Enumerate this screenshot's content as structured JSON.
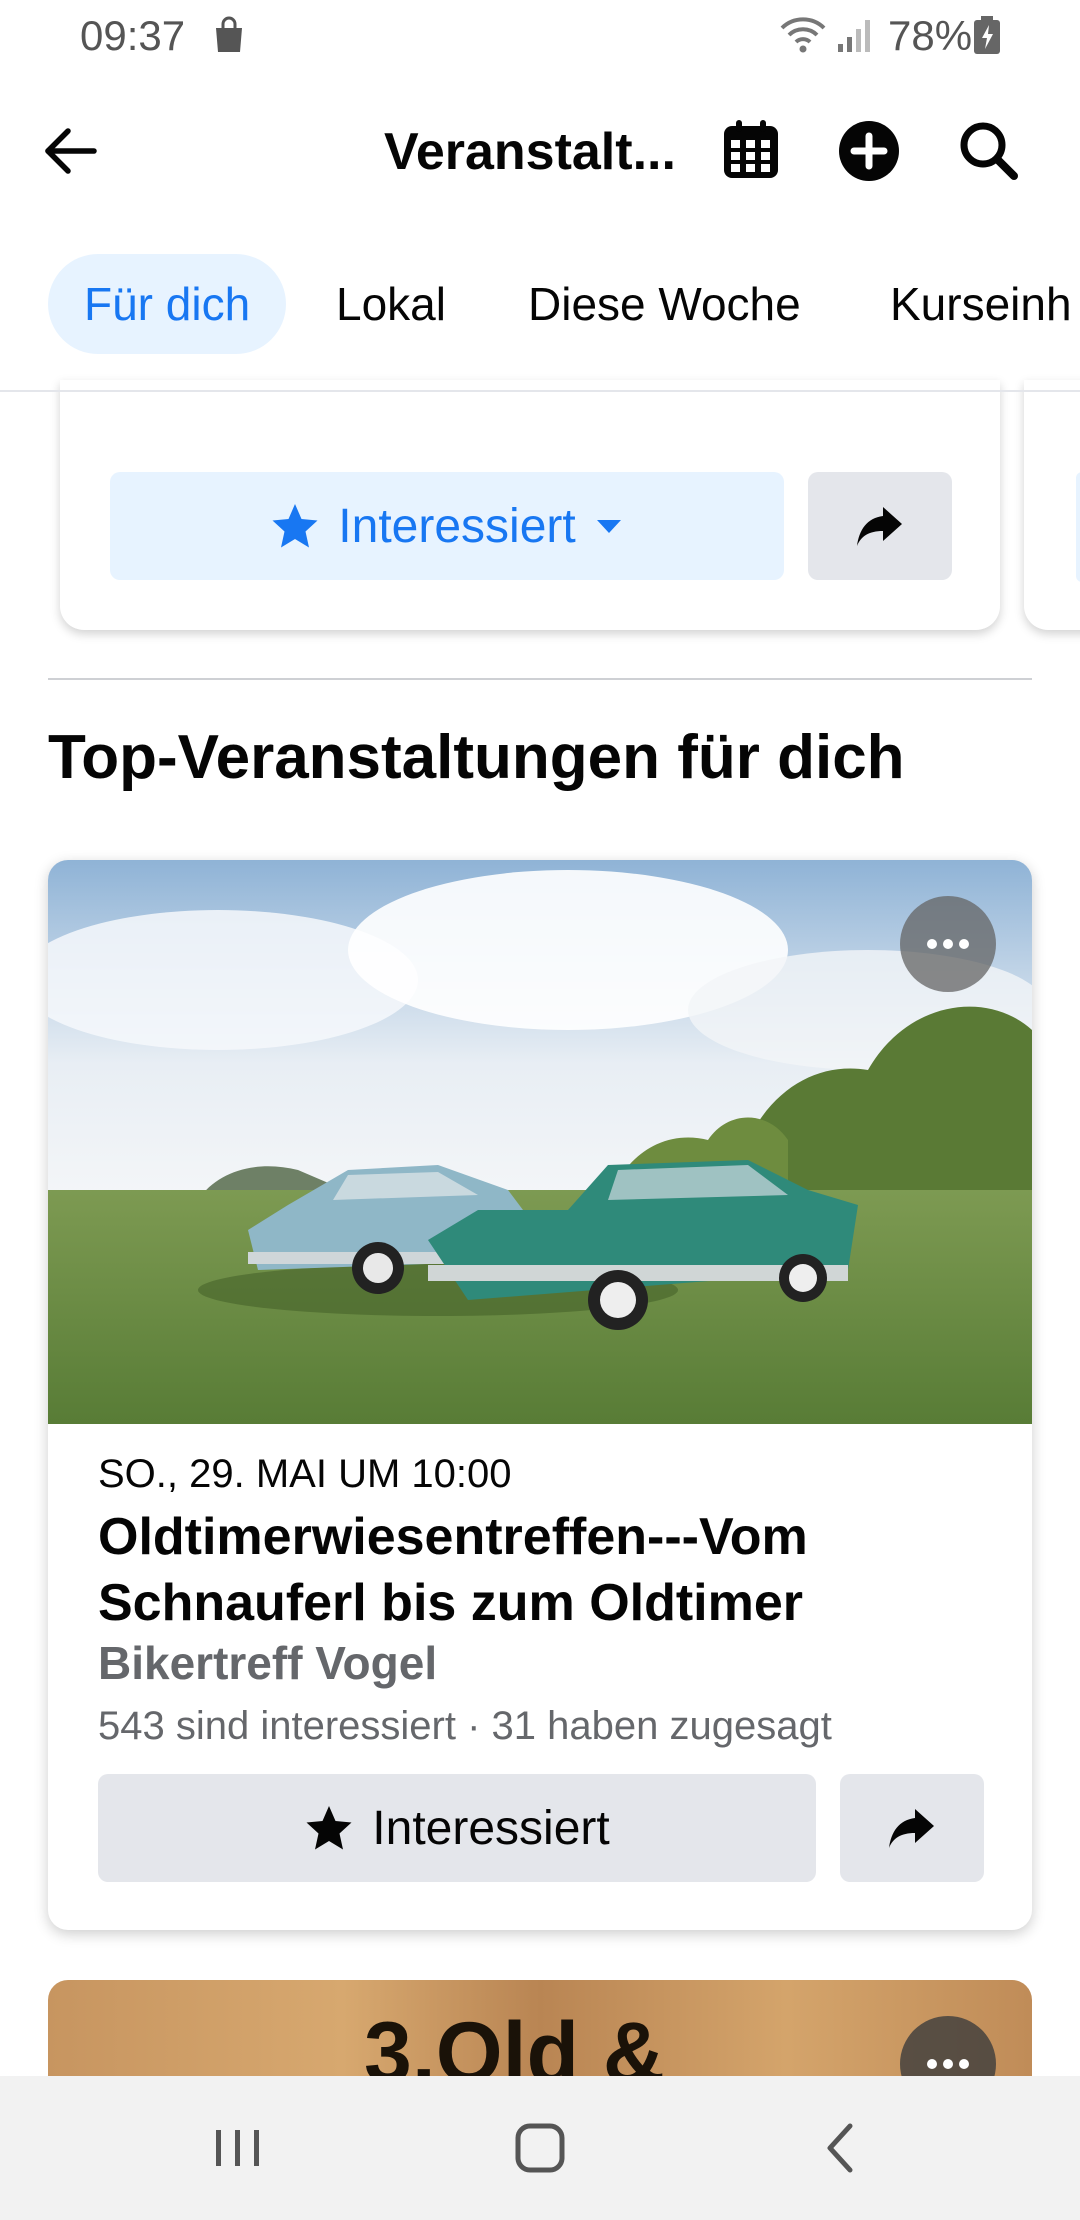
{
  "status_bar": {
    "time": "09:37",
    "battery": "78%",
    "icons": [
      "shopping-bag-icon",
      "wifi-icon",
      "signal-icon",
      "battery-icon"
    ]
  },
  "header": {
    "title": "Veranstalt...",
    "icons": [
      "back-arrow-icon",
      "calendar-icon",
      "plus-circle-icon",
      "search-icon"
    ]
  },
  "tabs": [
    {
      "label": "Für dich",
      "active": true
    },
    {
      "label": "Lokal",
      "active": false
    },
    {
      "label": "Diese Woche",
      "active": false
    },
    {
      "label": "Kurseinh",
      "active": false
    }
  ],
  "previous_card": {
    "interested_label": "Interessiert"
  },
  "section": {
    "title": "Top-Veranstaltungen für dich"
  },
  "event": {
    "date": "SO., 29. MAI UM 10:00",
    "title": "Oldtimerwiesentreffen---Vom Schnauferl bis zum Oldtimer",
    "place": "Bikertreff Vogel",
    "stats": "543 sind interessiert · 31 haben zugesagt",
    "interested_label": "Interessiert"
  },
  "next_event": {
    "image_text": "3.Old &"
  },
  "colors": {
    "accent": "#1877f2",
    "accent_bg": "#e7f3ff",
    "button_grey": "#e4e6eb",
    "secondary_text": "#65676b"
  }
}
